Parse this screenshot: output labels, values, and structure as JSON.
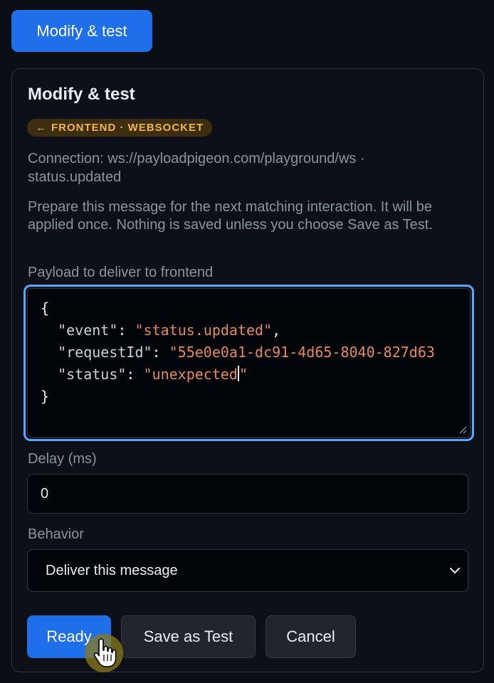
{
  "top_button": {
    "label": "Modify & test"
  },
  "panel": {
    "title": "Modify & test",
    "badge": {
      "arrow": "←",
      "text": "FRONTEND · WEBSOCKET"
    },
    "connection_text": "Connection: ws://payloadpigeon.com/playground/ws · status.updated",
    "description": "Prepare this message for the next matching interaction. It will be applied once. Nothing is saved unless you choose Save as Test.",
    "payload_label": "Payload to deliver to frontend",
    "payload": {
      "open_brace": "{",
      "close_brace": "}",
      "lines": [
        {
          "key": "\"event\"",
          "sep": ": ",
          "value": "\"status.updated\"",
          "trail": ","
        },
        {
          "key": "\"requestId\"",
          "sep": ": ",
          "value": "\"55e0e0a1-dc91-4d65-8040-827d63",
          "trail": ""
        },
        {
          "key": "\"status\"",
          "sep": ": ",
          "value_before_caret": "\"unexpected",
          "value_after_caret": "\"",
          "trail": ""
        }
      ]
    },
    "delay_label": "Delay (ms)",
    "delay_value": "0",
    "behavior_label": "Behavior",
    "behavior_selected": "Deliver this message",
    "buttons": {
      "ready": "Ready",
      "save_as_test": "Save as Test",
      "cancel": "Cancel"
    }
  },
  "colors": {
    "accent": "#1f6feb",
    "focus_ring": "#58a6ff",
    "badge_text": "#f2b44b",
    "string_value": "#e58b5a"
  },
  "icons": {
    "resize_handle": "resize-handle-icon",
    "select_chevron": "chevron-down-icon",
    "cursor": "hand-pointer-icon"
  }
}
